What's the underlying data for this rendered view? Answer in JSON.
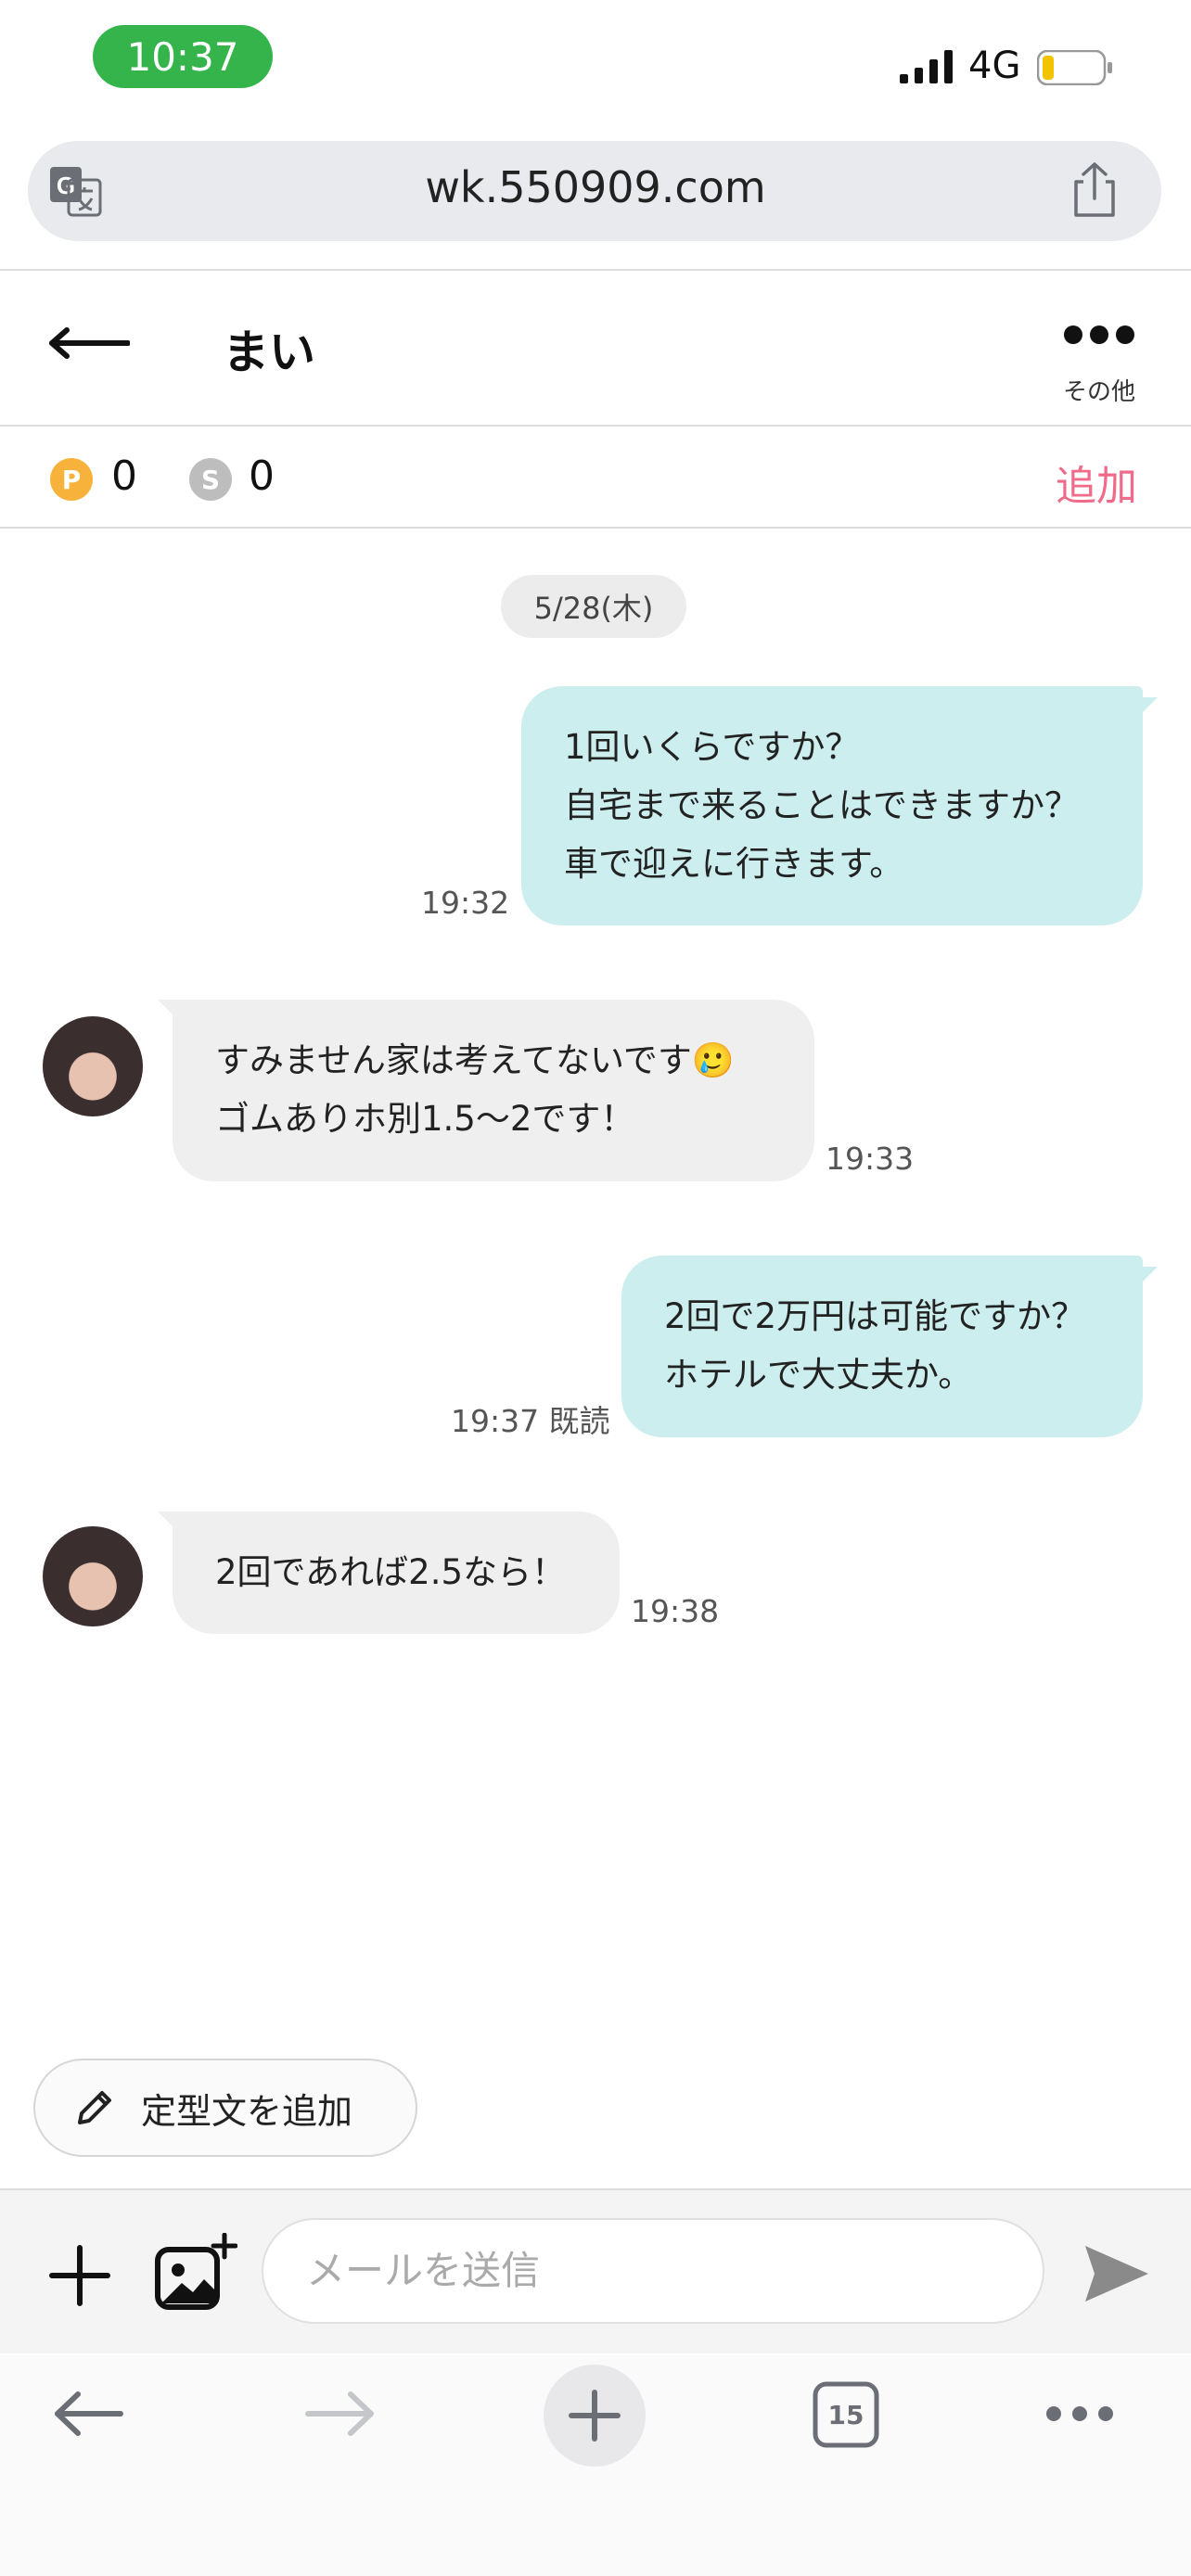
{
  "status": {
    "time": "10:37",
    "network": "4G",
    "battery_color": "#f2c300"
  },
  "browser": {
    "url": "wk.550909.com",
    "tabs_count": "15"
  },
  "chat": {
    "title": "まい",
    "more_label": "その他",
    "points": [
      {
        "badge": "P",
        "value": "0",
        "color": "#f7b23b"
      },
      {
        "badge": "S",
        "value": "0",
        "color": "#bdbdbd"
      }
    ],
    "add_label": "追加",
    "date": "5/28(木)",
    "messages": [
      {
        "dir": "out",
        "lines": [
          "1回いくらですか？",
          "自宅まで来ることはできますか？",
          "車で迎えに行きます。"
        ],
        "time": "19:32"
      },
      {
        "dir": "in",
        "lines": [
          "すみません家は考えてないです🥲",
          "ゴムありホ別1.5〜2です！"
        ],
        "time": "19:33"
      },
      {
        "dir": "out",
        "lines": [
          "2回で2万円は可能ですか？",
          "ホテルで大丈夫か。"
        ],
        "time": "19:37 既読"
      },
      {
        "dir": "in",
        "lines": [
          "2回であれば2.5なら！"
        ],
        "time": "19:38"
      }
    ]
  },
  "composer": {
    "template_label": "定型文を追加",
    "placeholder": "メールを送信"
  },
  "colors": {
    "accent": "#f06a8a",
    "bubble_out": "#cdeeee",
    "bubble_in": "#efefef",
    "status_green": "#34b44a"
  }
}
